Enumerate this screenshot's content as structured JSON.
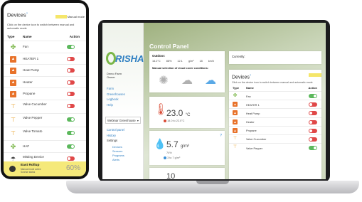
{
  "phone": {
    "title": "Devices",
    "title_sup": "?",
    "mode_label": "Manual mode",
    "subtitle": "Click on the device icon to switch between manual and automatic mode",
    "col_type": "Type",
    "col_name": "Name",
    "col_action": "Action",
    "devices": [
      {
        "name": "Fan",
        "icon": "fan-icon",
        "on": true
      },
      {
        "name": "HEATER 1",
        "icon": "heater-icon",
        "on": false
      },
      {
        "name": "Heat Pump",
        "icon": "heater-icon",
        "on": false
      },
      {
        "name": "Heater",
        "icon": "heater-icon",
        "on": false
      },
      {
        "name": "Propane",
        "icon": "heater-icon",
        "on": false
      },
      {
        "name": "Valve Cucumber",
        "icon": "valve-icon",
        "on": false
      },
      {
        "name": "Valve Pepper",
        "icon": "valve-icon",
        "on": true
      },
      {
        "name": "Valve Tomato",
        "icon": "valve-icon",
        "on": true
      },
      {
        "name": "HAF",
        "icon": "fan-icon",
        "on": true
      },
      {
        "name": "Misting Device",
        "icon": "mist-icon",
        "on": false
      }
    ],
    "rollup": {
      "name": "East Rollup",
      "desc_line1": "Manual mode active",
      "desc_line2": "Sunrise status",
      "value": "60%",
      "level": 0.6
    }
  },
  "laptop": {
    "sidebar": {
      "logo_text": "RISHA",
      "user_line1": "Demo Farm",
      "user_line2": "Owner",
      "nav": [
        "Farm",
        "Greenhouses",
        "Logbook",
        "Help"
      ],
      "greenhouse_select": "Webinar Greenhouse",
      "sub_nav": [
        "Control panel",
        "History"
      ],
      "settings_label": "Settings",
      "settings_items": [
        "Devices",
        "Sensors",
        "Programs",
        "Alerts"
      ]
    },
    "main": {
      "title": "Control Panel",
      "outdoor": {
        "label": "Outdoor:",
        "values": [
          "16.2°C",
          "86%",
          "12.1 g/m³",
          "18 km/h"
        ],
        "manual_label": "Manual selection of cloud cover conditions:",
        "weather_icons": [
          "sun-icon",
          "cloud-sun-icon",
          "cloud-icon"
        ]
      },
      "currently_label": "Currently:",
      "temperature": {
        "value": "23.0",
        "unit": "°C",
        "range": "18.0 to 22.0°C"
      },
      "humidity": {
        "value": "5.7",
        "unit": "g/m³",
        "pct": "74%",
        "range": "3 to 7 g/m³",
        "pin": "?"
      },
      "co2": {
        "value": "10"
      }
    },
    "devices": {
      "title": "Devices",
      "title_sup": "?",
      "subtitle": "Click on the device icon to switch between manual and automatic mode",
      "col_type": "Type",
      "col_name": "Name",
      "col_action": "Action",
      "rows": [
        {
          "name": "Fan",
          "icon": "fan-icon",
          "on": true
        },
        {
          "name": "HEATER 1",
          "icon": "heater-icon",
          "on": false
        },
        {
          "name": "Heat Pump",
          "icon": "heater-icon",
          "on": false
        },
        {
          "name": "Heater",
          "icon": "heater-icon",
          "on": false
        },
        {
          "name": "Propane",
          "icon": "heater-icon",
          "on": false
        },
        {
          "name": "Valve Cucumber",
          "icon": "valve-icon",
          "on": false
        },
        {
          "name": "Valve Pepper",
          "icon": "valve-icon",
          "on": true
        }
      ]
    }
  },
  "colors": {
    "toggle_on": "#5cb85c",
    "toggle_off": "#e04848",
    "heater": "#e8722a",
    "brand_blue": "#2f7fc2",
    "brand_green": "#7ab648",
    "rollup_bg": "#f5e97a"
  }
}
